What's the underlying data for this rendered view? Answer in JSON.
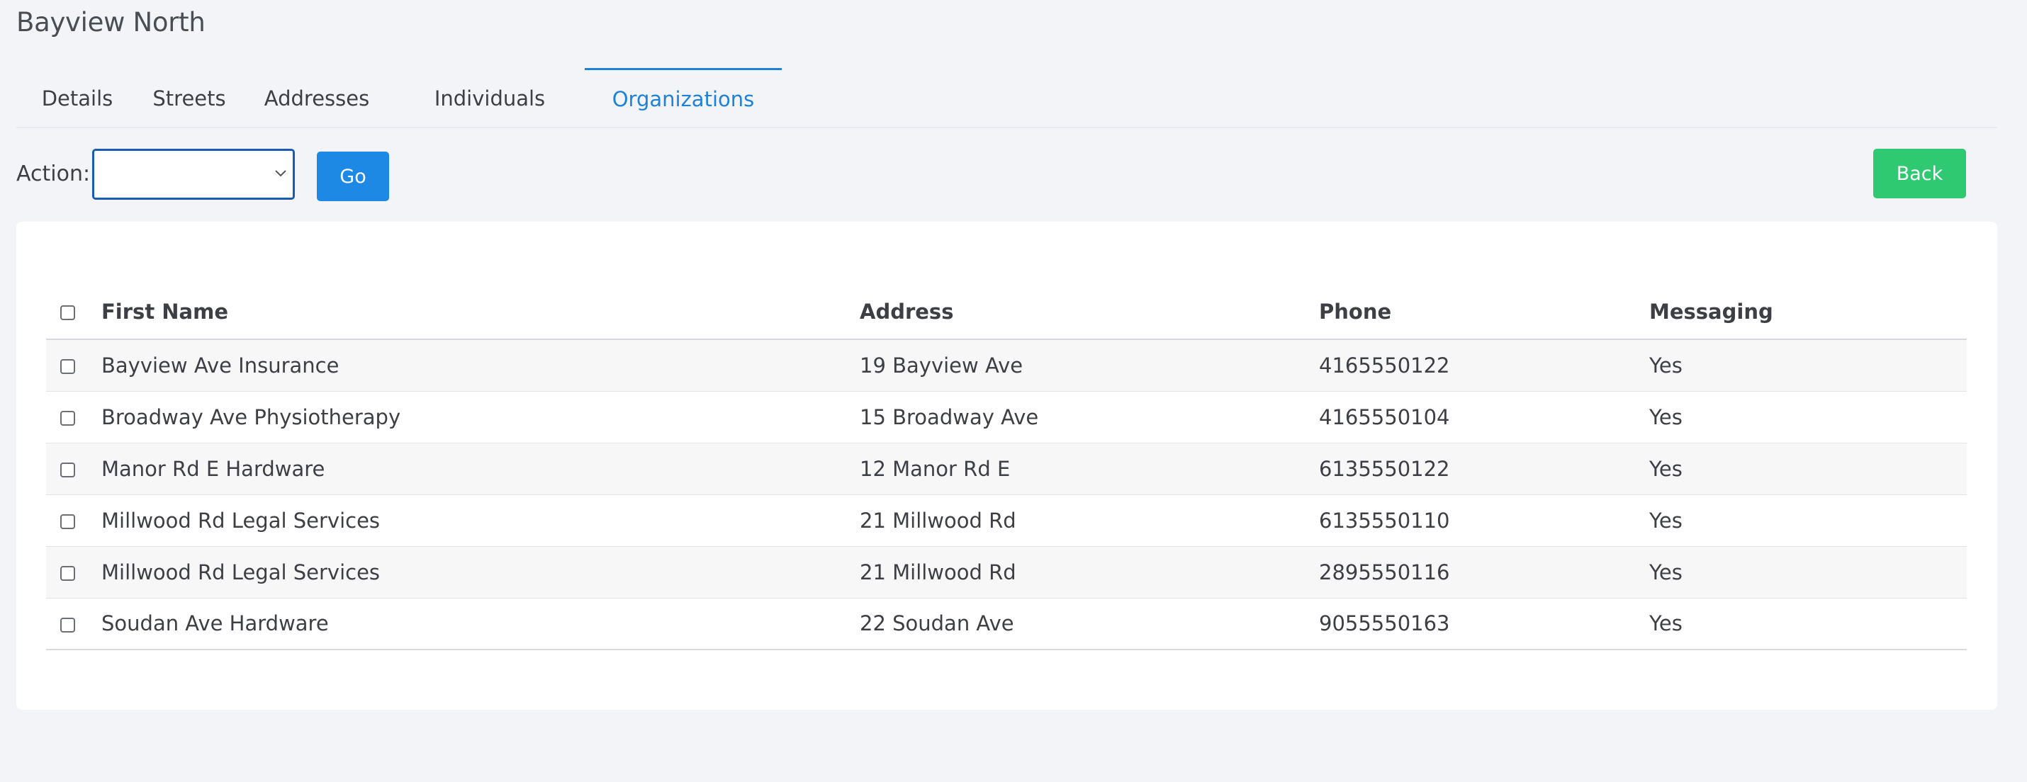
{
  "page": {
    "title": "Bayview North"
  },
  "tabs": [
    {
      "label": "Details",
      "active": false
    },
    {
      "label": "Streets",
      "active": false
    },
    {
      "label": "Addresses",
      "active": false
    },
    {
      "label": "Individuals",
      "active": false
    },
    {
      "label": "Organizations",
      "active": true
    }
  ],
  "actions": {
    "label": "Action:",
    "selected": "",
    "go_label": "Go",
    "back_label": "Back"
  },
  "table": {
    "headers": {
      "name": "First Name",
      "address": "Address",
      "phone": "Phone",
      "messaging": "Messaging"
    },
    "rows": [
      {
        "name": "Bayview Ave Insurance",
        "address": "19 Bayview Ave",
        "phone": "4165550122",
        "messaging": "Yes"
      },
      {
        "name": "Broadway Ave Physiotherapy",
        "address": "15 Broadway Ave",
        "phone": "4165550104",
        "messaging": "Yes"
      },
      {
        "name": "Manor Rd E Hardware",
        "address": "12 Manor Rd E",
        "phone": "6135550122",
        "messaging": "Yes"
      },
      {
        "name": "Millwood Rd Legal Services",
        "address": "21 Millwood Rd",
        "phone": "6135550110",
        "messaging": "Yes"
      },
      {
        "name": "Millwood Rd Legal Services",
        "address": "21 Millwood Rd",
        "phone": "2895550116",
        "messaging": "Yes"
      },
      {
        "name": "Soudan Ave Hardware",
        "address": "22 Soudan Ave",
        "phone": "9055550163",
        "messaging": "Yes"
      }
    ]
  },
  "colors": {
    "accent": "#1e82d6",
    "go": "#1e88e5",
    "back": "#2ec971",
    "background": "#f3f4f7"
  }
}
